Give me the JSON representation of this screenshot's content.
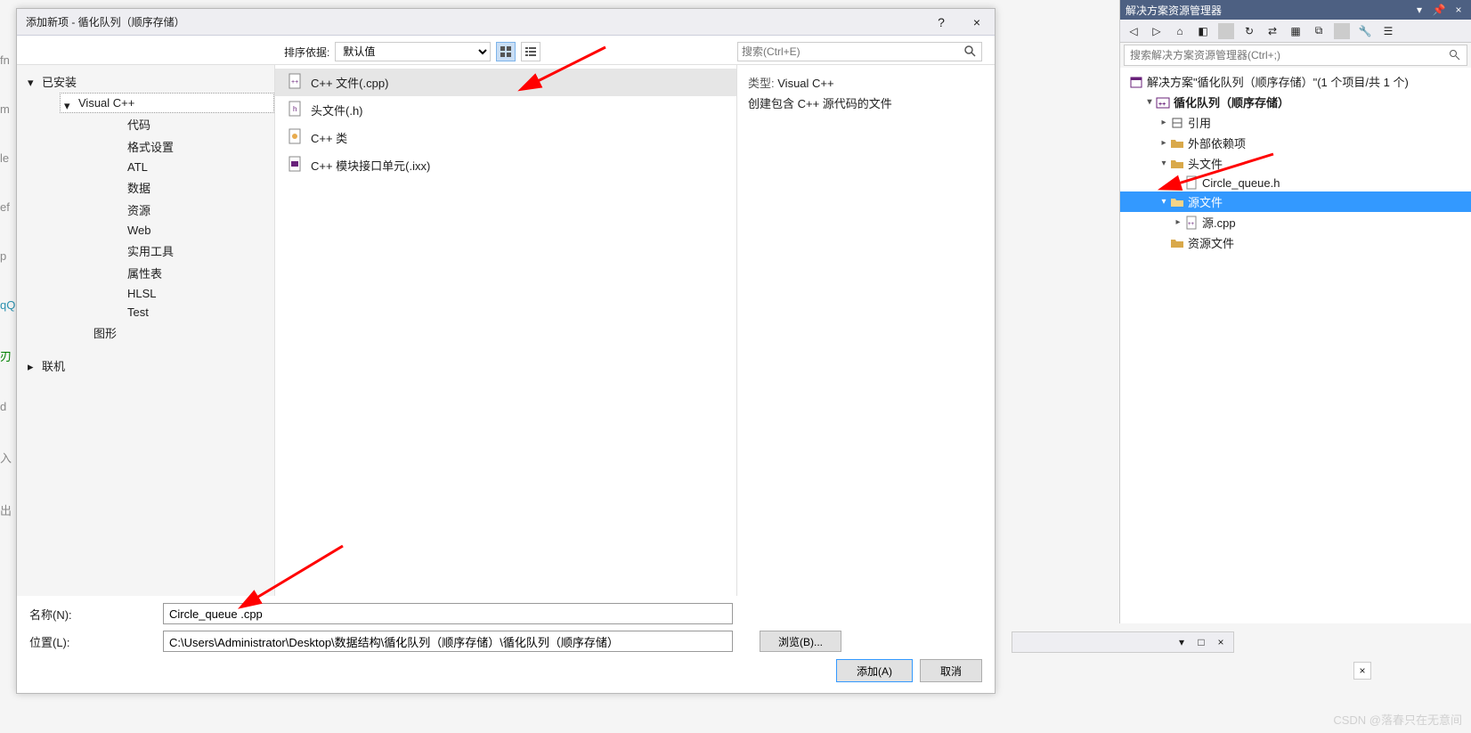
{
  "dialog": {
    "title": "添加新项 - 循化队列（顺序存储）",
    "help": "?",
    "close": "×",
    "sort_label": "排序依据:",
    "sort_value": "默认值",
    "search_placeholder": "搜索(Ctrl+E)",
    "tree": {
      "installed": "已安装",
      "visual_cpp": "Visual C++",
      "items": [
        "代码",
        "格式设置",
        "ATL",
        "数据",
        "资源",
        "Web",
        "实用工具",
        "属性表",
        "HLSL",
        "Test"
      ],
      "graphics": "图形",
      "online": "联机"
    },
    "templates": [
      "C++ 文件(.cpp)",
      "头文件(.h)",
      "C++ 类",
      "C++ 模块接口单元(.ixx)"
    ],
    "desc": {
      "type_label": "类型:",
      "type_value": "Visual C++",
      "detail": "创建包含 C++ 源代码的文件"
    },
    "form": {
      "name_label": "名称(N):",
      "name_value": "Circle_queue .cpp",
      "location_label": "位置(L):",
      "location_value": "C:\\Users\\Administrator\\Desktop\\数据结构\\循化队列（顺序存储）\\循化队列（顺序存储）",
      "browse": "浏览(B)...",
      "add": "添加(A)",
      "cancel": "取消"
    }
  },
  "sln": {
    "title": "解决方案资源管理器",
    "search_placeholder": "搜索解决方案资源管理器(Ctrl+;)",
    "root": "解决方案\"循化队列（顺序存储）\"(1 个项目/共 1 个)",
    "project": "循化队列（顺序存储）",
    "refs": "引用",
    "external": "外部依赖项",
    "headers": "头文件",
    "header_file": "Circle_queue.h",
    "sources": "源文件",
    "source_file": "源.cpp",
    "resources": "资源文件"
  },
  "watermark": "CSDN @落春只在无意间"
}
